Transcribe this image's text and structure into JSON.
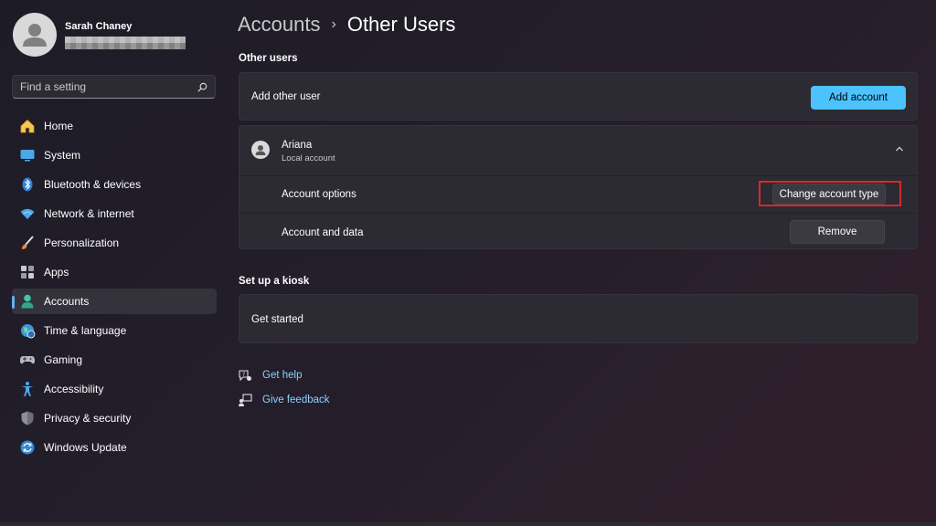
{
  "profile": {
    "name": "Sarah Chaney"
  },
  "search": {
    "placeholder": "Find a setting"
  },
  "sidebar": {
    "items": [
      {
        "label": "Home",
        "icon": "home-icon"
      },
      {
        "label": "System",
        "icon": "system-icon"
      },
      {
        "label": "Bluetooth & devices",
        "icon": "bluetooth-icon"
      },
      {
        "label": "Network & internet",
        "icon": "network-icon"
      },
      {
        "label": "Personalization",
        "icon": "brush-icon"
      },
      {
        "label": "Apps",
        "icon": "apps-icon"
      },
      {
        "label": "Accounts",
        "icon": "accounts-icon",
        "active": true
      },
      {
        "label": "Time & language",
        "icon": "globe-icon"
      },
      {
        "label": "Gaming",
        "icon": "gamepad-icon"
      },
      {
        "label": "Accessibility",
        "icon": "accessibility-icon"
      },
      {
        "label": "Privacy & security",
        "icon": "shield-icon"
      },
      {
        "label": "Windows Update",
        "icon": "update-icon"
      }
    ]
  },
  "breadcrumb": {
    "parent": "Accounts",
    "separator": "›",
    "current": "Other Users"
  },
  "other_users": {
    "title": "Other users",
    "add_label": "Add other user",
    "add_button": "Add account"
  },
  "user": {
    "name": "Ariana",
    "type": "Local account",
    "options_label": "Account options",
    "change_button": "Change account type",
    "data_label": "Account and data",
    "remove_button": "Remove"
  },
  "kiosk": {
    "title": "Set up a kiosk",
    "get_started": "Get started"
  },
  "links": {
    "help": "Get help",
    "feedback": "Give feedback"
  },
  "colors": {
    "accent": "#4cc2ff",
    "highlight": "#d42b2b",
    "link": "#8fd0ff"
  }
}
